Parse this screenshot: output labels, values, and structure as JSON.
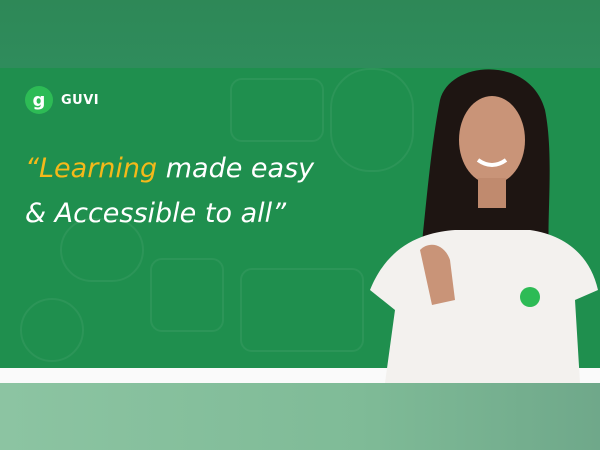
{
  "brand": {
    "name": "GUVI",
    "logo_glyph": "g"
  },
  "headline": {
    "quote_open": "“",
    "accent_word": "Learning",
    "line1_rest": " made easy",
    "line2": "& Accessible to all”"
  },
  "colors": {
    "banner": "#1f8f4e",
    "accent": "#f4b91a",
    "logo": "#2dbb55"
  }
}
